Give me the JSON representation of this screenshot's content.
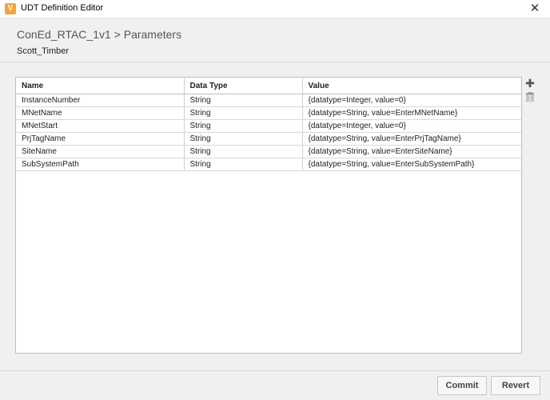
{
  "window": {
    "title": "UDT Definition Editor",
    "close_glyph": "✕",
    "app_icon_glyph": "V"
  },
  "header": {
    "breadcrumb": "ConEd_RTAC_1v1 > Parameters",
    "subtitle": "Scott_Timber"
  },
  "table": {
    "columns": [
      "Name",
      "Data Type",
      "Value"
    ],
    "rows": [
      {
        "name": "InstanceNumber",
        "data_type": "String",
        "value": "{datatype=Integer, value=0}"
      },
      {
        "name": "MNetName",
        "data_type": "String",
        "value": "{datatype=String, value=EnterMNetName}"
      },
      {
        "name": "MNetStart",
        "data_type": "String",
        "value": "{datatype=Integer, value=0}"
      },
      {
        "name": "PrjTagName",
        "data_type": "String",
        "value": "{datatype=String, value=EnterPrjTagName}"
      },
      {
        "name": "SiteName",
        "data_type": "String",
        "value": "{datatype=String, value=EnterSiteName}"
      },
      {
        "name": "SubSystemPath",
        "data_type": "String",
        "value": "{datatype=String, value=EnterSubSystemPath}"
      }
    ]
  },
  "actions": {
    "add_glyph": "✚",
    "icons": [
      "plus-icon",
      "trash-icon"
    ]
  },
  "footer": {
    "commit_label": "Commit",
    "revert_label": "Revert"
  }
}
